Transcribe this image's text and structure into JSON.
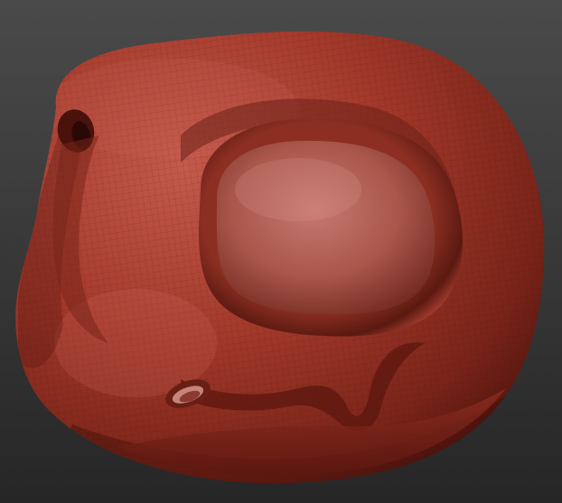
{
  "scene": {
    "subject": "sculpted-creature-head",
    "material_color": "#a0392b",
    "material_highlight": "#d9776a",
    "material_shadow": "#4e130d",
    "background_top": "#4a4a4a",
    "background_bottom": "#262626",
    "wireframe_visible": true
  }
}
